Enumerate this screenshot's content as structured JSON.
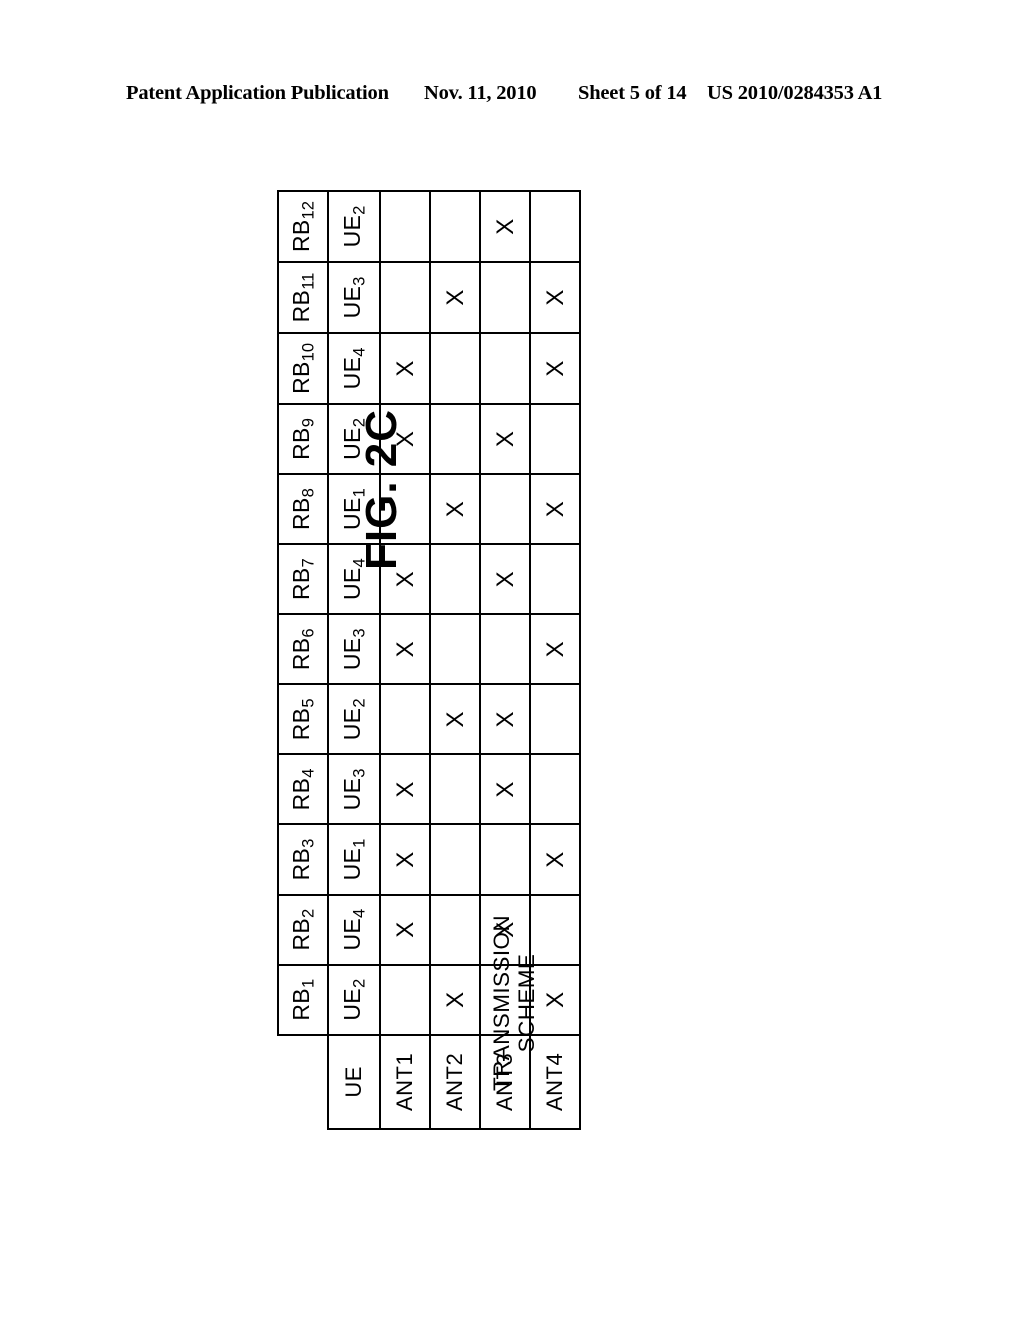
{
  "header": {
    "publication": "Patent Application Publication",
    "date": "Nov. 11, 2010",
    "sheet": "Sheet 5 of 14",
    "number": "US 2010/0284353 A1"
  },
  "figure": {
    "label": "FIG. 2C",
    "group_label_line1": "TRANSMISSION",
    "group_label_line2": "SCHEME",
    "ue_row_label": "UE",
    "corner_label": ""
  },
  "table": {
    "rb_columns": [
      "RB1",
      "RB2",
      "RB3",
      "RB4",
      "RB5",
      "RB6",
      "RB7",
      "RB8",
      "RB9",
      "RB10",
      "RB11",
      "RB12"
    ],
    "rb_bases": [
      "RB",
      "RB",
      "RB",
      "RB",
      "RB",
      "RB",
      "RB",
      "RB",
      "RB",
      "RB",
      "RB",
      "RB"
    ],
    "rb_subs": [
      "1",
      "2",
      "3",
      "4",
      "5",
      "6",
      "7",
      "8",
      "9",
      "10",
      "11",
      "12"
    ],
    "ue_bases": [
      "UE",
      "UE",
      "UE",
      "UE",
      "UE",
      "UE",
      "UE",
      "UE",
      "UE",
      "UE",
      "UE",
      "UE"
    ],
    "ue_subs": [
      "2",
      "4",
      "1",
      "3",
      "2",
      "3",
      "4",
      "1",
      "2",
      "4",
      "3",
      "2"
    ],
    "ant_rows": [
      "ANT1",
      "ANT2",
      "ANT3",
      "ANT4"
    ],
    "mark": "X",
    "matrix": [
      [
        0,
        1,
        1,
        1,
        0,
        1,
        1,
        0,
        1,
        1,
        0,
        0
      ],
      [
        1,
        0,
        0,
        0,
        1,
        0,
        0,
        1,
        0,
        0,
        1,
        0
      ],
      [
        0,
        1,
        0,
        1,
        1,
        0,
        1,
        0,
        1,
        0,
        0,
        1
      ],
      [
        1,
        0,
        1,
        0,
        0,
        1,
        0,
        1,
        0,
        1,
        1,
        0
      ]
    ]
  },
  "colors": {
    "ink": "#000000",
    "paper": "#ffffff"
  }
}
